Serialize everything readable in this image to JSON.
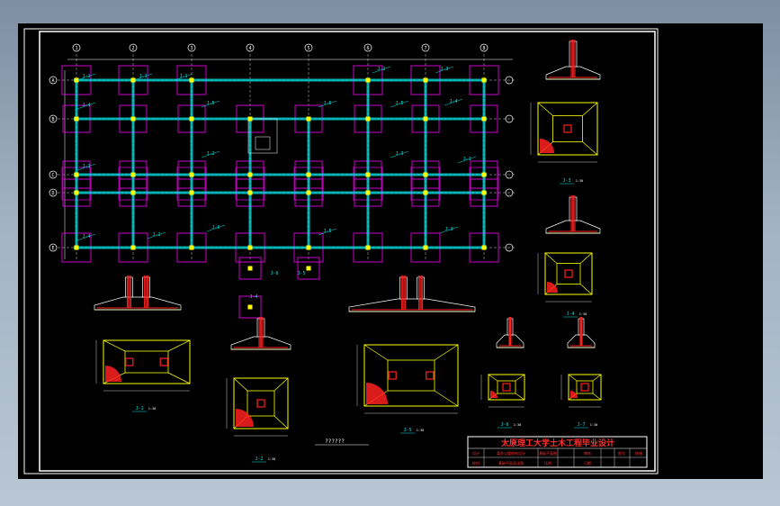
{
  "viewport": {
    "background": "#000000",
    "frame_color": "#ffffff"
  },
  "colors": {
    "column": "#00e5e5",
    "footing": "#cc00cc",
    "node": "#ffff00",
    "grid": "#ffffff",
    "detail_line": "#ffff00",
    "rebar": "#ff2020",
    "label": "#00e5e5",
    "title_text": "#ff3030"
  },
  "plan": {
    "axis_numbers": [
      "1",
      "2",
      "3",
      "4",
      "5",
      "6",
      "7",
      "8"
    ],
    "axis_letters": [
      "A",
      "B",
      "C",
      "D",
      "E"
    ],
    "footing_tags": [
      "J-1",
      "J-2",
      "J-3",
      "J-4",
      "J-5",
      "J-6"
    ]
  },
  "details": {
    "section_labels": [
      "J-1",
      "J-2",
      "J-3",
      "J-4",
      "J-5",
      "J-6",
      "J-7"
    ],
    "scale": "1:30",
    "scale_note": "??????"
  },
  "title_block": {
    "school": "太原理工大学土木工程毕业设计",
    "rows": [
      [
        "某办公楼结构设计",
        "基础平面图",
        "图号"
      ],
      [
        "基础平面及详图",
        "比例",
        "日期"
      ]
    ],
    "cells": [
      "设计",
      "校对",
      "审核",
      "结施"
    ]
  }
}
